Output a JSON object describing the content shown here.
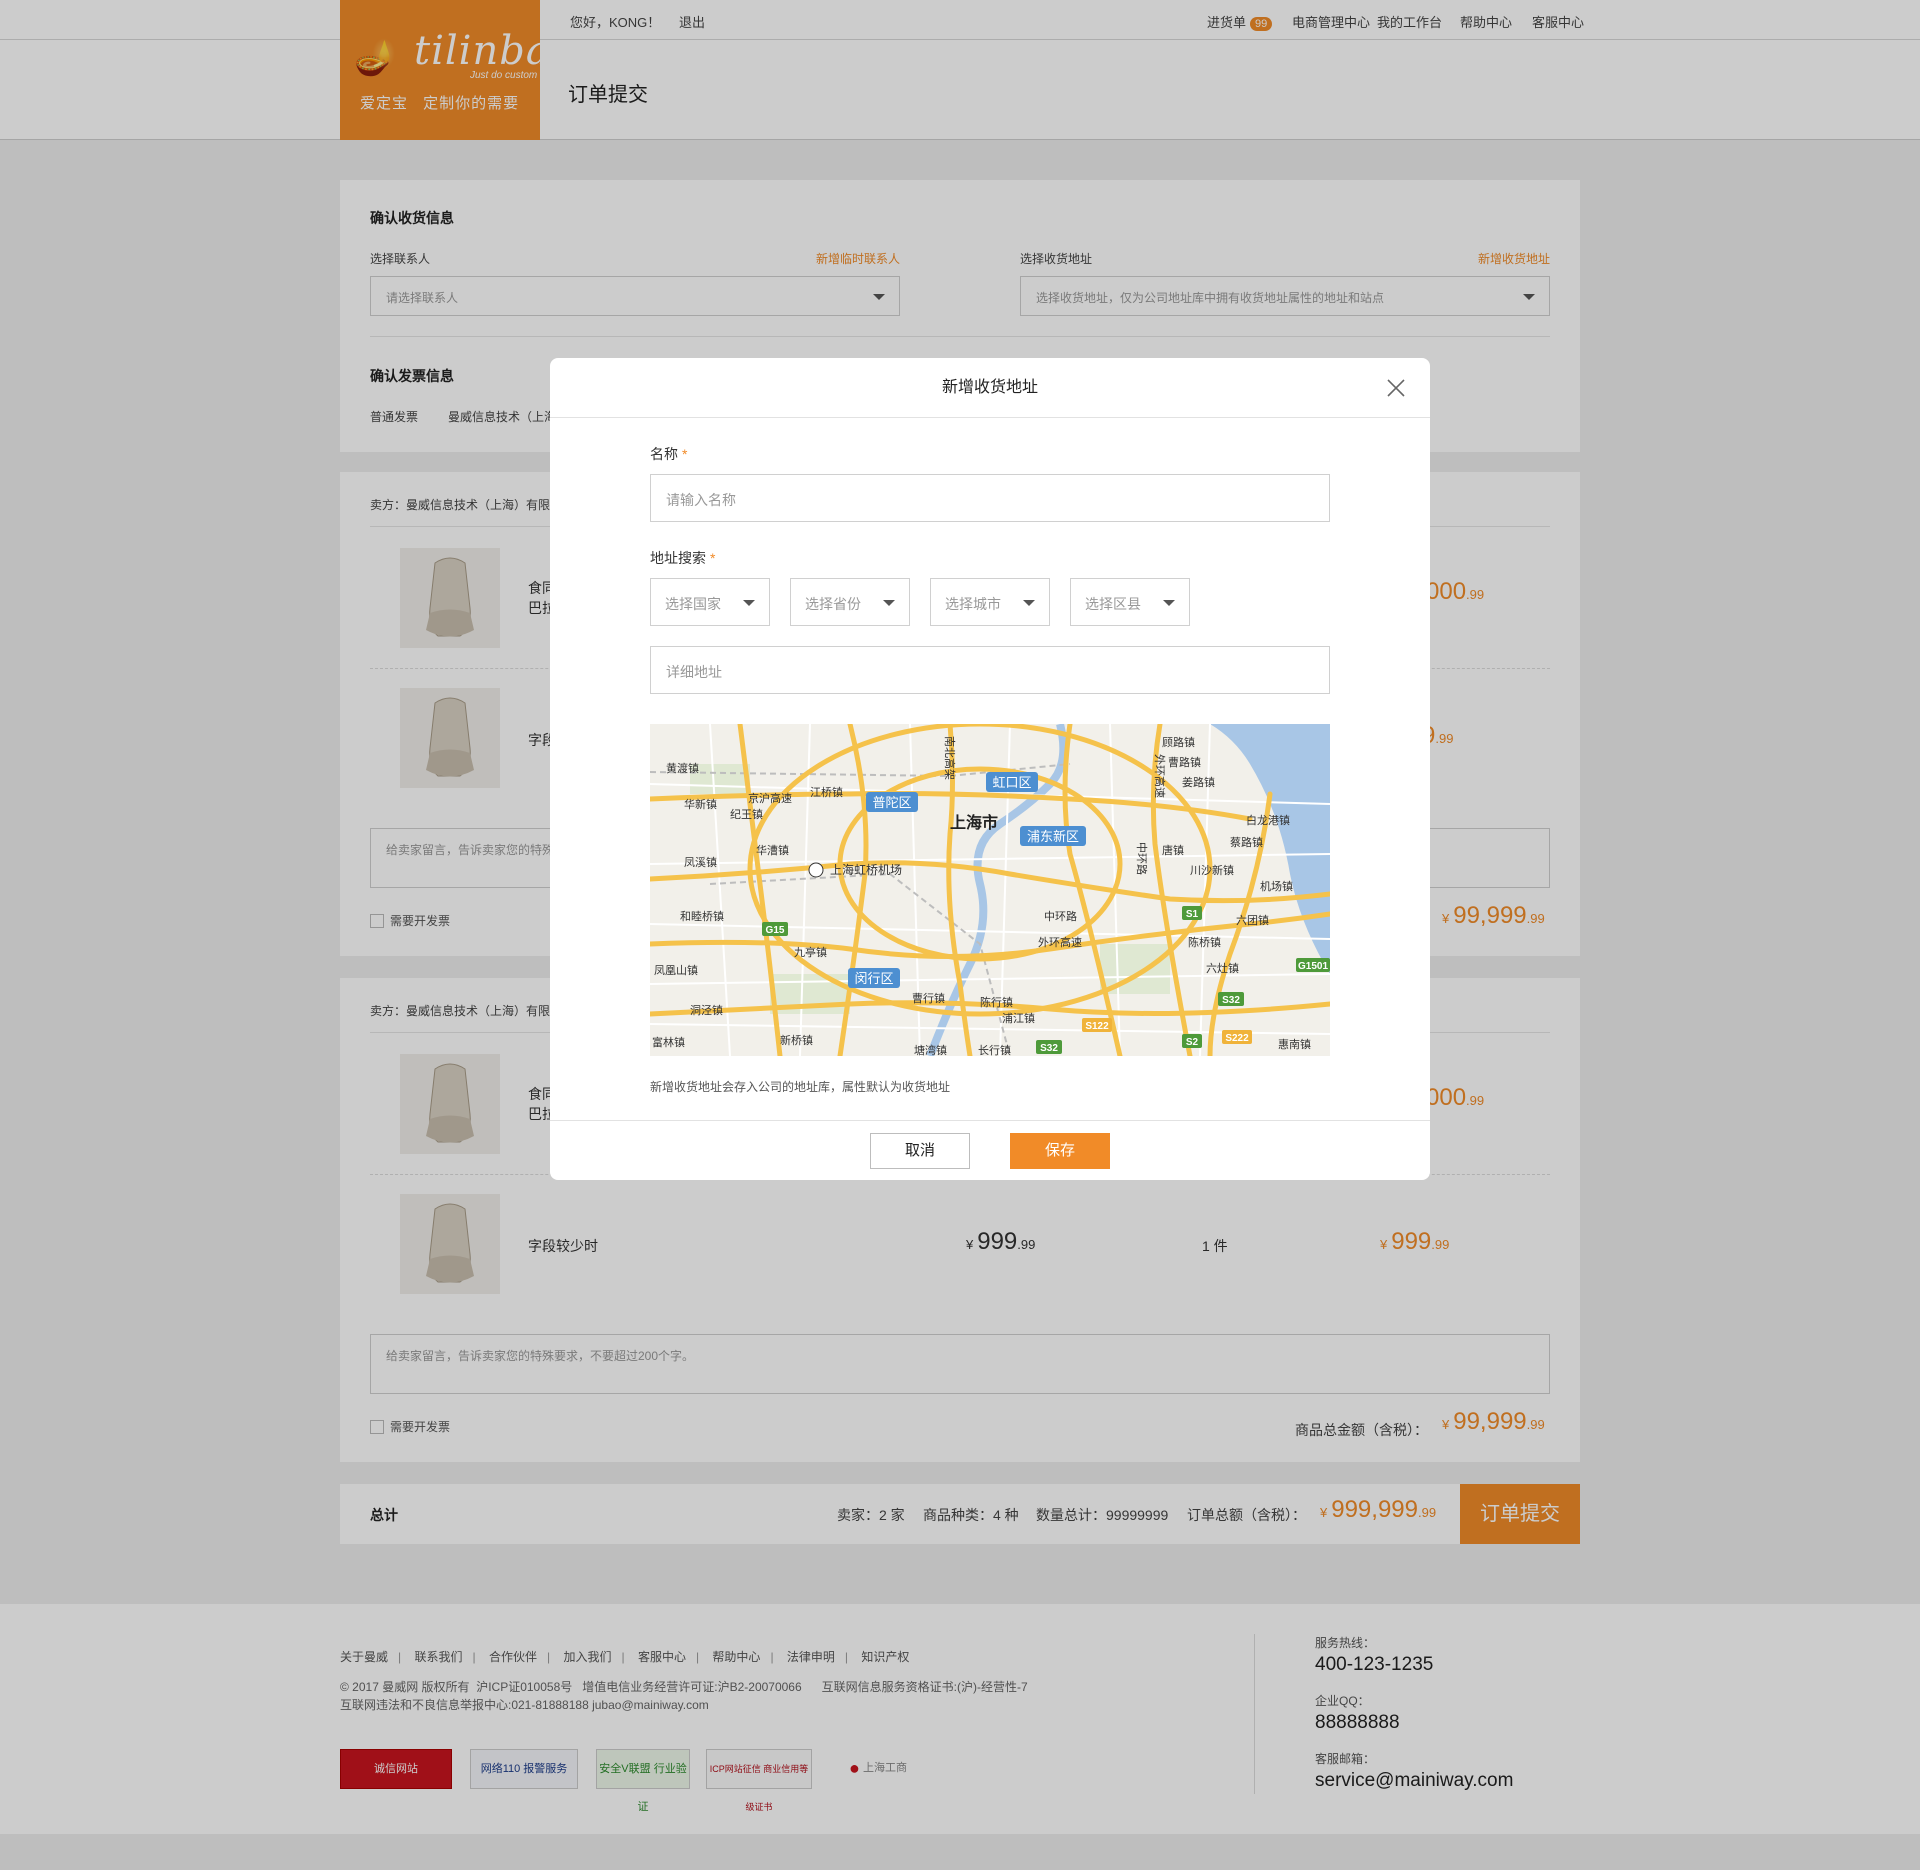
{
  "header": {
    "greeting": "您好，KONG！",
    "logout": "退出",
    "cart_label": "进货单",
    "cart_count": "99",
    "nav": [
      "电商管理中心",
      "我的工作台",
      "帮助中心",
      "客服中心"
    ],
    "page_title": "订单提交",
    "logo": {
      "script": "tilinbao",
      "sub": "Just do custom",
      "slogan": "爱定宝   定制你的需要"
    }
  },
  "receiver": {
    "title": "确认收货信息",
    "contact_label": "选择联系人",
    "contact_link": "新增临时联系人",
    "contact_placeholder": "请选择联系人",
    "address_label": "选择收货地址",
    "address_link": "新增收货地址",
    "address_placeholder": "选择收货地址，仅为公司地址库中拥有收货地址属性的地址和站点"
  },
  "invoice": {
    "title": "确认发票信息",
    "type": "普通发票",
    "company": "曼威信息技术（上海"
  },
  "orders": [
    {
      "seller": "卖方：曼威信息技术（上海）有限",
      "items": [
        {
          "name": "食同\n巴拉",
          "subtotal_int": "000",
          "subtotal_dec": ".99"
        },
        {
          "name": "字段",
          "subtotal_int": "9",
          "subtotal_dec": ".99"
        }
      ],
      "message_placeholder": "给卖家留言，告诉卖家您的特殊",
      "invoice_check": "需要开发票",
      "total_currency": "¥",
      "total_int": "99,999",
      "total_dec": ".99"
    },
    {
      "seller": "卖方：曼威信息技术（上海）有限",
      "items": [
        {
          "name": "食同\n巴拉",
          "subtotal_int": "000",
          "subtotal_dec": ".99"
        },
        {
          "name": "字段较少时",
          "price_currency": "¥",
          "price_int": "999",
          "price_dec": ".99",
          "qty": "1 件",
          "subtotal_currency": "¥",
          "subtotal_int": "999",
          "subtotal_dec": ".99"
        }
      ],
      "message_placeholder": "给卖家留言，告诉卖家您的特殊要求，不要超过200个字。",
      "invoice_check": "需要开发票",
      "total_label": "商品总金额（含税）：",
      "total_currency": "¥",
      "total_int": "99,999",
      "total_dec": ".99"
    }
  ],
  "summary": {
    "label": "总计",
    "sellers": "卖家：2 家",
    "kinds": "商品种类：4 种",
    "quantity": "数量总计：99999999",
    "amount_label": "订单总额（含税）：",
    "amount_currency": "¥",
    "amount_int": "999,999",
    "amount_dec": ".99",
    "submit": "订单提交"
  },
  "footer": {
    "links": [
      "关于曼威",
      "联系我们",
      "合作伙伴",
      "加入我们",
      "客服中心",
      "帮助中心",
      "法律申明",
      "知识产权"
    ],
    "copyright": "© 2017 曼威网 版权所有  沪ICP证010058号   增值电信业务经营许可证:沪B2-20070066      互联网信息服务资格证书:(沪)-经营性-7",
    "report": "互联网违法和不良信息举报中心:021-81888188 jubao@mainiway.com",
    "certs": [
      "诚信网站",
      "网络110 报警服务",
      "安全V联盟 行业验证",
      "ICP网站征信 商业信用等级证书",
      "上海工商"
    ],
    "hotline_label": "服务热线：",
    "hotline": "400-123-1235",
    "qq_label": "企业QQ：",
    "qq": "88888888",
    "email_label": "客服邮箱：",
    "email": "service@mainiway.com"
  },
  "modal": {
    "title": "新增收货地址",
    "name_label": "名称",
    "name_placeholder": "请输入名称",
    "address_label": "地址搜索",
    "required_mark": "*",
    "country": "选择国家",
    "province": "选择省份",
    "city": "选择城市",
    "district": "选择区县",
    "detail_placeholder": "详细地址",
    "note": "新增收货地址会存入公司的地址库，属性默认为收货地址",
    "cancel": "取消",
    "save": "保存",
    "map_labels": {
      "center": "上海市",
      "districts": [
        "普陀区",
        "虹口区",
        "浦东新区",
        "闵行区"
      ],
      "airport": "上海虹桥机场",
      "towns": [
        "黄渡镇",
        "华新镇",
        "纪王镇",
        "江桥镇",
        "京沪高速",
        "华漕镇",
        "凤溪镇",
        "和睦桥镇",
        "九亭镇",
        "凤凰山镇",
        "洞泾镇",
        "富林镇",
        "新桥镇",
        "曹行镇",
        "陈行镇",
        "浦江镇",
        "顾路镇",
        "曹路镇",
        "姜路镇",
        "白龙港镇",
        "蔡路镇",
        "唐镇",
        "川沙新镇",
        "机场镇",
        "六团镇",
        "陈桥镇",
        "六灶镇",
        "惠南镇",
        "中环路",
        "外环高速",
        "外环高速",
        "中环路",
        "南北高架",
        "塘湾镇",
        "长行镇"
      ],
      "shields": [
        "G15",
        "S1",
        "G1501",
        "S32",
        "S122",
        "S32",
        "S2",
        "S222"
      ]
    }
  },
  "colors": {
    "accent": "#f18b28",
    "overlay": "rgba(0,0,0,0.2)"
  }
}
